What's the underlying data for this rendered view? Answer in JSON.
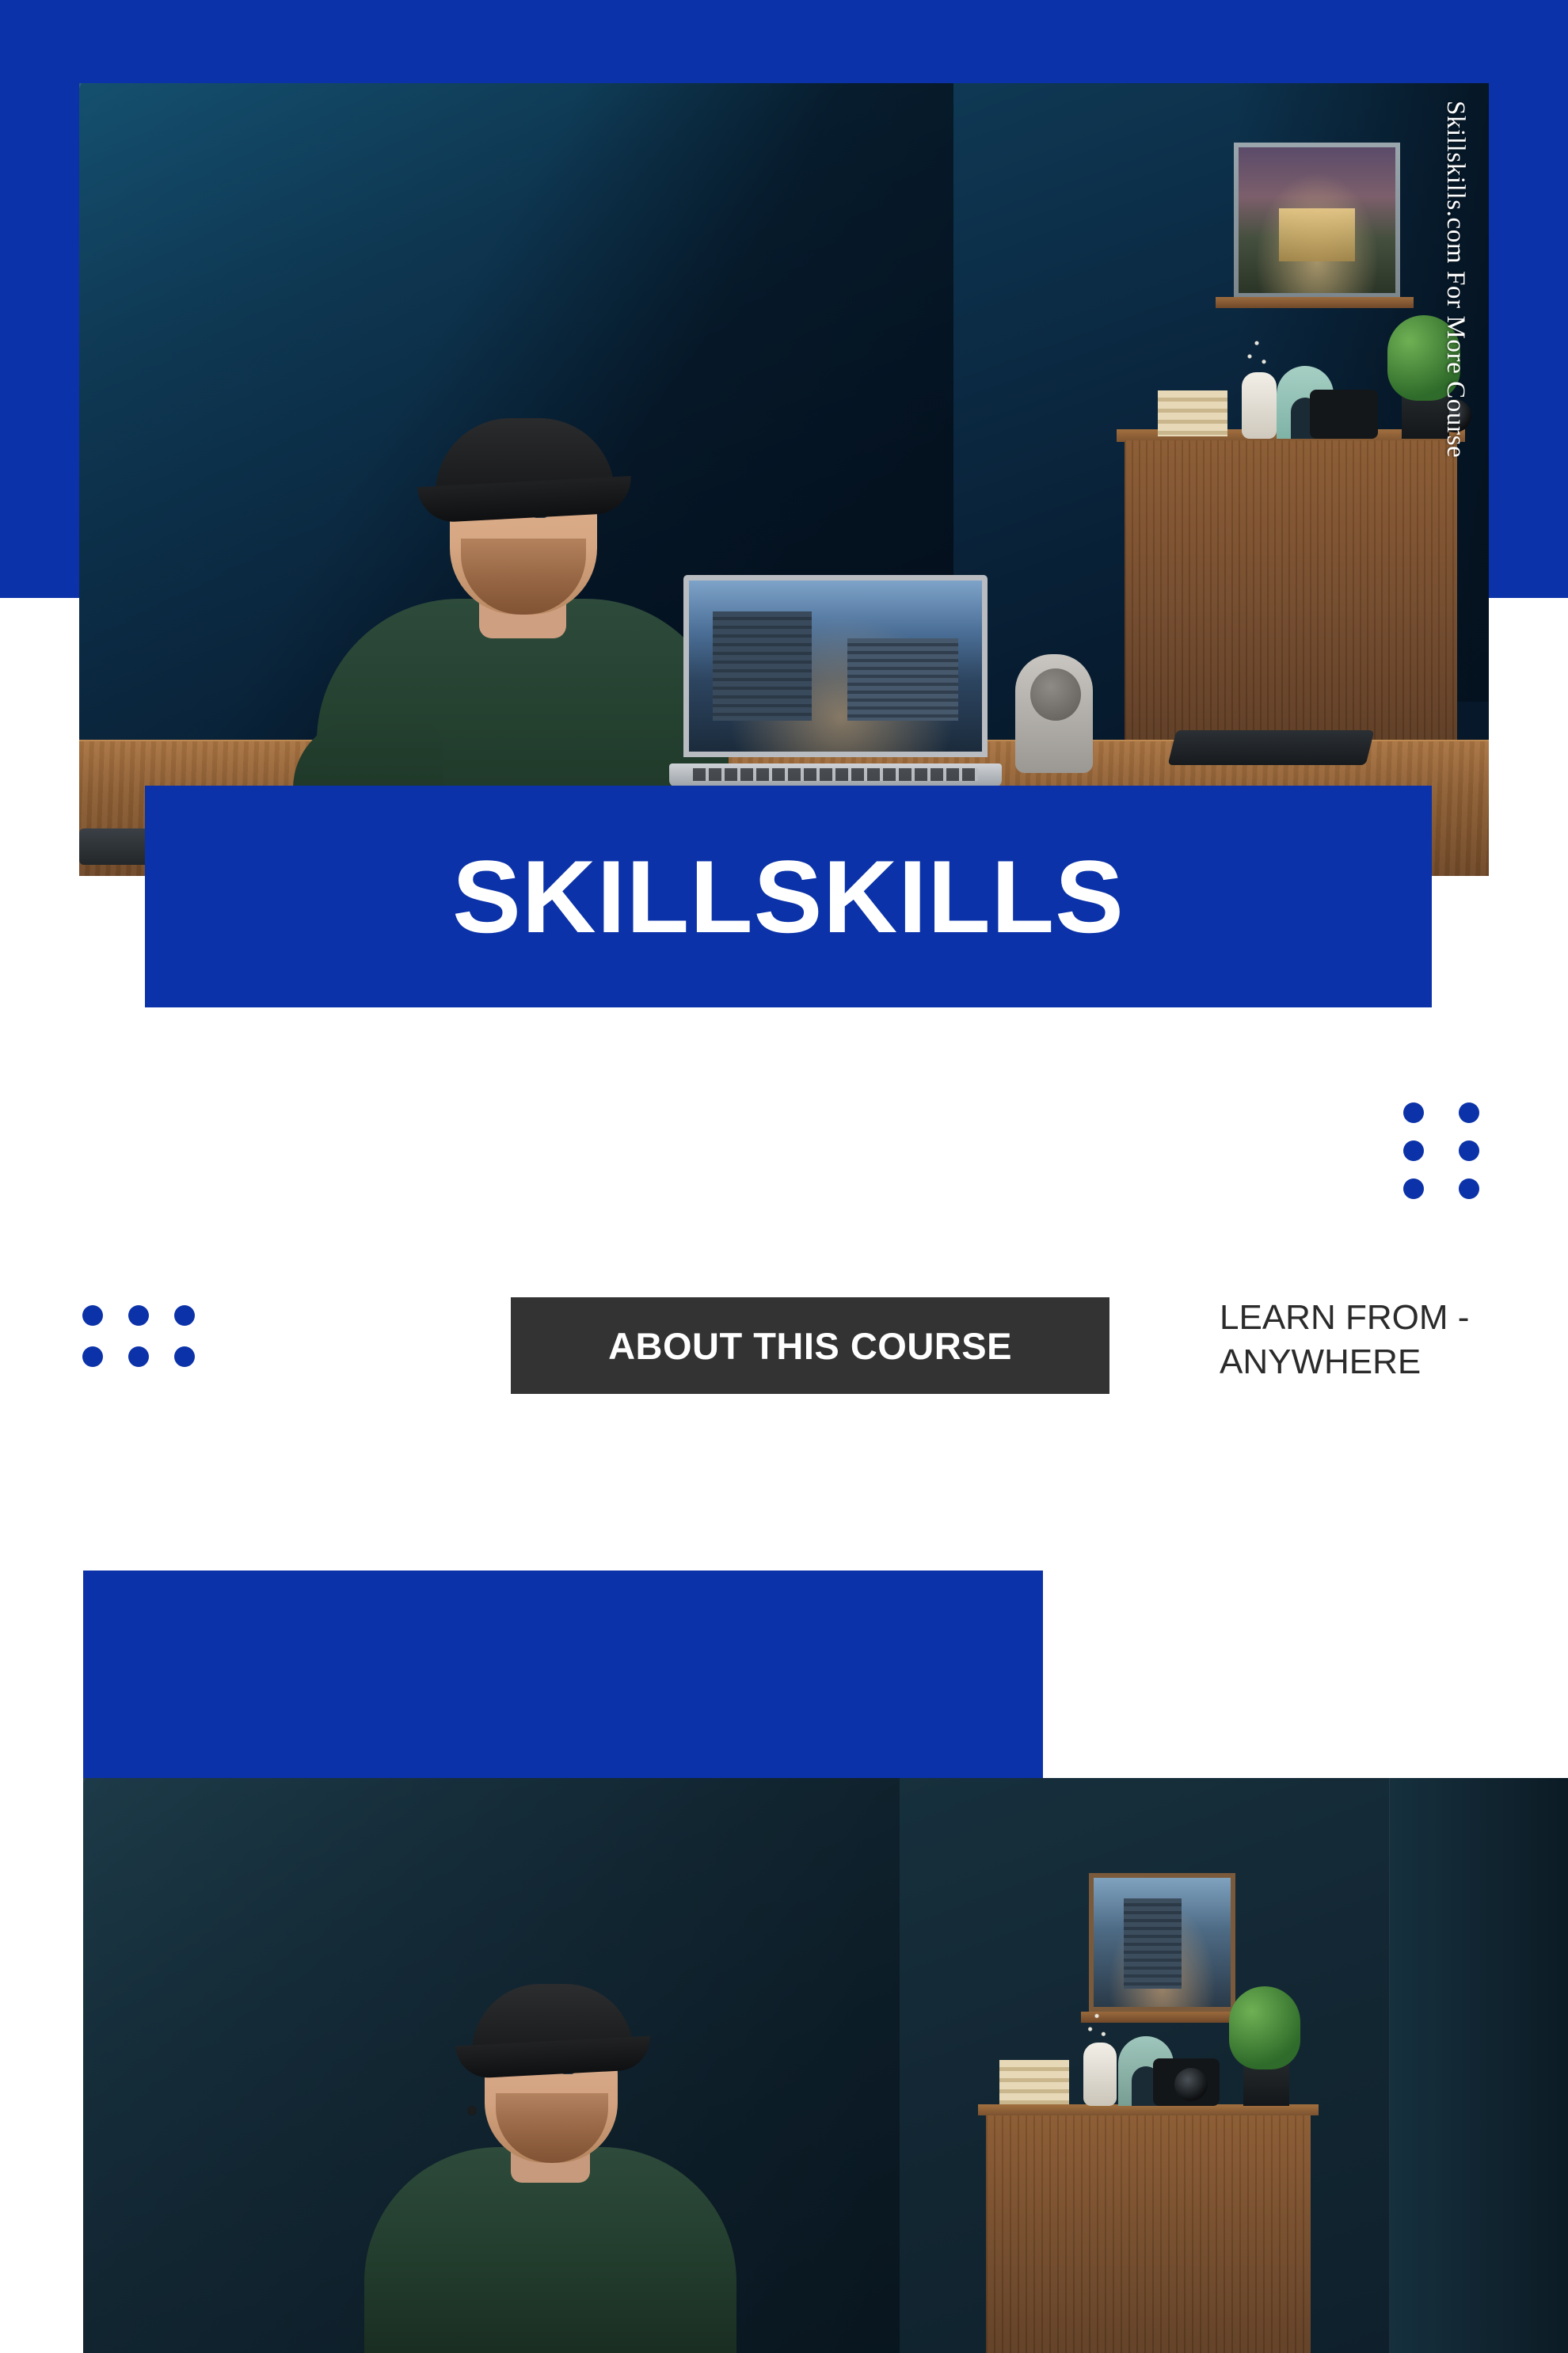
{
  "brand": {
    "accent_blue": "#0B32A8",
    "chip_dark": "#333333",
    "text_dark": "#2B2B2B",
    "white": "#FFFFFF"
  },
  "hero": {
    "watermark_text": "Skillskills.com For More Course",
    "photo_alt": "Man in black cap and dark green t-shirt seated at a wooden desk with an open laptop showing an architectural render, a smart speaker, drawing tablet and stylus; dark blue wall with framed building artwork on a shelf and a walnut sideboard with books, vase, camera and plant"
  },
  "title_banner": {
    "text": "SKILLSKILLS"
  },
  "decor": {
    "dots_right": {
      "icon": "dot-grid-icon",
      "columns": 2,
      "rows": 3,
      "count": 6
    },
    "dots_left": {
      "icon": "dot-grid-icon",
      "columns": 3,
      "rows": 2,
      "count": 6
    }
  },
  "section_header": {
    "chip_label": "ABOUT THIS COURSE",
    "note_line_1": "LEARN FROM -",
    "note_line_2": "ANYWHERE",
    "note_full": "LEARN FROM - ANYWHERE"
  },
  "lower": {
    "blue_block_label": "",
    "photo_alt": "Same man in black cap and dark green t-shirt speaking to camera; dark blue wall, framed city building artwork on a wooden shelf, walnut sideboard with books, vase, camera and potted plant"
  }
}
